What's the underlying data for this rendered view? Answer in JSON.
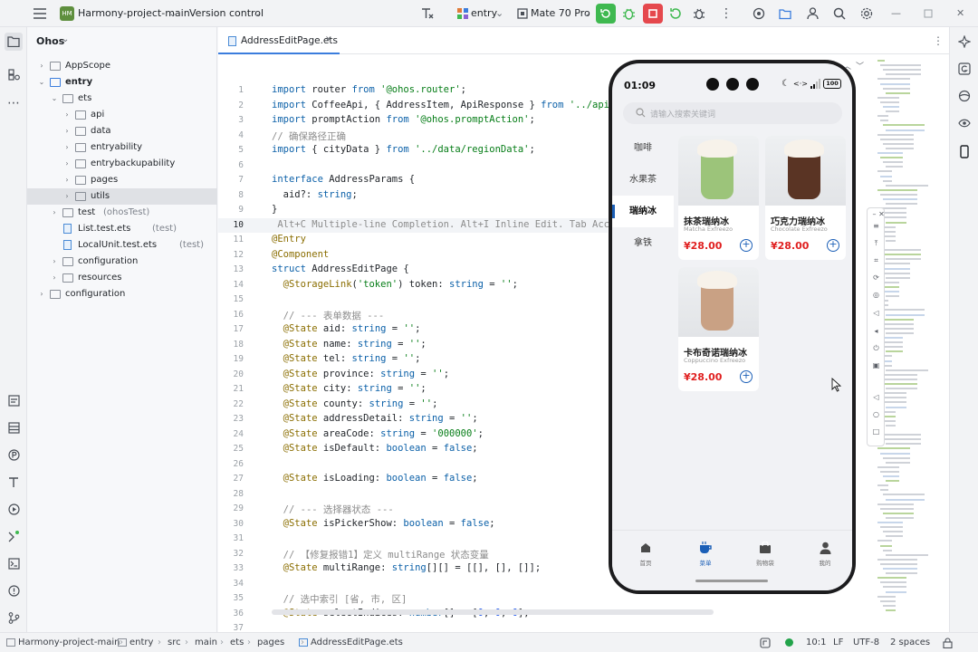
{
  "topbar": {
    "project_badge": "HM",
    "project_name": "Harmony-project-main",
    "vcs": "Version control",
    "run_target": "entry",
    "device": "Mate 70 Pro"
  },
  "project_panel": {
    "title": "Ohos",
    "tree": [
      {
        "label": "AppScope",
        "kind": "folder",
        "indent": 0,
        "arrow": "›"
      },
      {
        "label": "entry",
        "kind": "module",
        "indent": 0,
        "arrow": "⌄",
        "bold": true
      },
      {
        "label": "ets",
        "kind": "folder",
        "indent": 1,
        "arrow": "⌄"
      },
      {
        "label": "api",
        "kind": "folder",
        "indent": 2,
        "arrow": "›"
      },
      {
        "label": "data",
        "kind": "folder",
        "indent": 2,
        "arrow": "›"
      },
      {
        "label": "entryability",
        "kind": "folder",
        "indent": 2,
        "arrow": "›"
      },
      {
        "label": "entrybackupability",
        "kind": "folder",
        "indent": 2,
        "arrow": "›"
      },
      {
        "label": "pages",
        "kind": "folder",
        "indent": 2,
        "arrow": "›"
      },
      {
        "label": "utils",
        "kind": "folder",
        "indent": 2,
        "arrow": "›",
        "selected": true
      },
      {
        "label": "test",
        "suffix": "(ohosTest)",
        "kind": "folder",
        "indent": 1,
        "arrow": "›"
      },
      {
        "label": "List.test.ets",
        "suffix": "(test)",
        "kind": "file",
        "indent": 1,
        "arrow": ""
      },
      {
        "label": "LocalUnit.test.ets",
        "suffix": "(test)",
        "kind": "file",
        "indent": 1,
        "arrow": ""
      },
      {
        "label": "configuration",
        "kind": "folder",
        "indent": 1,
        "arrow": "›"
      },
      {
        "label": "resources",
        "kind": "folder",
        "indent": 1,
        "arrow": "›"
      },
      {
        "label": "configuration",
        "kind": "folder",
        "indent": 0,
        "arrow": "›"
      }
    ]
  },
  "editor": {
    "tab_name": "AddressEditPage.ets",
    "lines": [
      {
        "n": "1",
        "html": "<span class='kw'>import</span> router <span class='kw'>from</span> <span class='str'>'@ohos.router'</span>;"
      },
      {
        "n": "2",
        "html": "<span class='kw'>import</span> CoffeeApi, { AddressItem, ApiResponse } <span class='kw'>from</span> <span class='str'>'../api/Co</span>"
      },
      {
        "n": "3",
        "html": "<span class='kw'>import</span> promptAction <span class='kw'>from</span> <span class='str'>'@ohos.promptAction'</span>;"
      },
      {
        "n": "4",
        "html": "<span class='cm'>// 确保路径正确</span>"
      },
      {
        "n": "5",
        "html": "<span class='kw'>import</span> { cityData } <span class='kw'>from</span> <span class='str'>'../data/regionData'</span>;"
      },
      {
        "n": "6",
        "html": ""
      },
      {
        "n": "7",
        "html": "<span class='kw'>interface</span> AddressParams {"
      },
      {
        "n": "8",
        "html": "  aid?: <span class='kw'>string</span>;"
      },
      {
        "n": "9",
        "html": "}"
      },
      {
        "n": "10",
        "html": "<span class='cm'> Alt+C Multiple-line Completion. Alt+I Inline Edit. Tab Accept</span>"
      },
      {
        "n": "11",
        "html": "<span class='dec'>@Entry</span>"
      },
      {
        "n": "12",
        "html": "<span class='dec'>@Component</span>"
      },
      {
        "n": "13",
        "html": "<span class='kw'>struct</span> AddressEditPage {"
      },
      {
        "n": "14",
        "html": "  <span class='dec'>@StorageLink</span>(<span class='str'>'token'</span>) token: <span class='kw'>string</span> = <span class='str'>''</span>;"
      },
      {
        "n": "15",
        "html": ""
      },
      {
        "n": "16",
        "html": "  <span class='cm'>// --- 表单数据 ---</span>"
      },
      {
        "n": "17",
        "html": "  <span class='dec'>@State</span> aid: <span class='kw'>string</span> = <span class='str'>''</span>;"
      },
      {
        "n": "18",
        "html": "  <span class='dec'>@State</span> name: <span class='kw'>string</span> = <span class='str'>''</span>;"
      },
      {
        "n": "19",
        "html": "  <span class='dec'>@State</span> tel: <span class='kw'>string</span> = <span class='str'>''</span>;"
      },
      {
        "n": "20",
        "html": "  <span class='dec'>@State</span> province: <span class='kw'>string</span> = <span class='str'>''</span>;"
      },
      {
        "n": "21",
        "html": "  <span class='dec'>@State</span> city: <span class='kw'>string</span> = <span class='str'>''</span>;"
      },
      {
        "n": "22",
        "html": "  <span class='dec'>@State</span> county: <span class='kw'>string</span> = <span class='str'>''</span>;"
      },
      {
        "n": "23",
        "html": "  <span class='dec'>@State</span> addressDetail: <span class='kw'>string</span> = <span class='str'>''</span>;"
      },
      {
        "n": "24",
        "html": "  <span class='dec'>@State</span> areaCode: <span class='kw'>string</span> = <span class='str'>'000000'</span>;"
      },
      {
        "n": "25",
        "html": "  <span class='dec'>@State</span> isDefault: <span class='kw'>boolean</span> = <span class='kw'>false</span>;"
      },
      {
        "n": "26",
        "html": ""
      },
      {
        "n": "27",
        "html": "  <span class='dec'>@State</span> isLoading: <span class='kw'>boolean</span> = <span class='kw'>false</span>;"
      },
      {
        "n": "28",
        "html": ""
      },
      {
        "n": "29",
        "html": "  <span class='cm'>// --- 选择器状态 ---</span>"
      },
      {
        "n": "30",
        "html": "  <span class='dec'>@State</span> isPickerShow: <span class='kw'>boolean</span> = <span class='kw'>false</span>;"
      },
      {
        "n": "31",
        "html": ""
      },
      {
        "n": "32",
        "html": "  <span class='cm'>// 【修复报错1】定义 multiRange 状态变量</span>"
      },
      {
        "n": "33",
        "html": "  <span class='dec'>@State</span> multiRange: <span class='kw'>string</span>[][] = [[], [], []];"
      },
      {
        "n": "34",
        "html": ""
      },
      {
        "n": "35",
        "html": "  <span class='cm'>// 选中索引 [省, 市, 区]</span>"
      },
      {
        "n": "36",
        "html": "  <span class='dec'>@State</span> selectIndices: <span class='kw'>number</span>[] = [<span class='num'>0</span>, <span class='num'>0</span>, <span class='num'>0</span>];"
      },
      {
        "n": "37",
        "html": ""
      }
    ]
  },
  "phone": {
    "time": "01:09",
    "battery": "100",
    "search_placeholder": "请输入搜索关键词",
    "categories": [
      "咖啡",
      "水果茶",
      "瑞纳冰",
      "拿铁"
    ],
    "active_category": "瑞纳冰",
    "products": [
      {
        "name": "抹茶瑞纳冰",
        "en": "Matcha Exfreezo",
        "price": "¥28.00",
        "color": "#9cc47a"
      },
      {
        "name": "巧克力瑞纳冰",
        "en": "Chocolate Exfreezo",
        "price": "¥28.00",
        "color": "#5a3424"
      },
      {
        "name": "卡布奇诺瑞纳冰",
        "en": "Coppuccino Exfreezo",
        "price": "¥28.00",
        "color": "#c9a184"
      }
    ],
    "tabs": [
      {
        "label": "首页",
        "icon": "home-icon"
      },
      {
        "label": "菜单",
        "icon": "cup-icon",
        "active": true
      },
      {
        "label": "购物袋",
        "icon": "bag-icon"
      },
      {
        "label": "我的",
        "icon": "user-icon"
      }
    ]
  },
  "status": {
    "crumbs": [
      "Harmony-project-main",
      "entry",
      "src",
      "main",
      "ets",
      "pages",
      "AddressEditPage.ets"
    ],
    "position": "10:1",
    "line_ending": "LF",
    "encoding": "UTF-8",
    "indent": "2 spaces"
  },
  "colors": {
    "accent": "#1b5fb7",
    "price": "#e02020",
    "run_green": "#3fb950",
    "stop_red": "#e5484d"
  }
}
